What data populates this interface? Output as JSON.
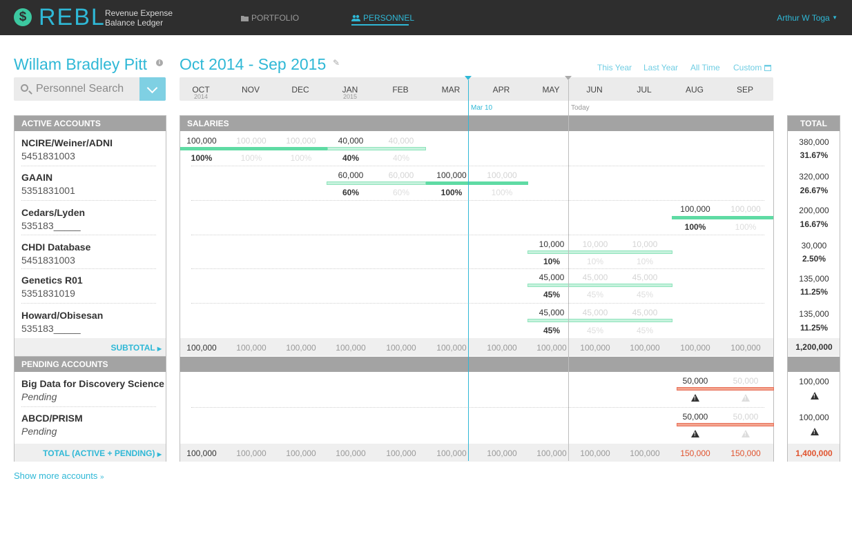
{
  "app": {
    "logo_glyph": "$",
    "name": "REBL",
    "subtitle_line1": "Revenue Expense",
    "subtitle_line2": "Balance Ledger"
  },
  "nav": {
    "portfolio": "PORTFOLIO",
    "personnel": "PERSONNEL",
    "user": "Arthur W Toga"
  },
  "person": {
    "name": "Willam Bradley Pitt"
  },
  "range": {
    "label": "Oct 2014 - Sep 2015",
    "quick": [
      "This Year",
      "Last Year",
      "All Time",
      "Custom"
    ]
  },
  "search": {
    "placeholder": "Personnel Search"
  },
  "months": [
    {
      "m": "OCT",
      "y": "2014"
    },
    {
      "m": "NOV",
      "y": ""
    },
    {
      "m": "DEC",
      "y": ""
    },
    {
      "m": "JAN",
      "y": "2015"
    },
    {
      "m": "FEB",
      "y": ""
    },
    {
      "m": "MAR",
      "y": ""
    },
    {
      "m": "APR",
      "y": ""
    },
    {
      "m": "MAY",
      "y": ""
    },
    {
      "m": "JUN",
      "y": ""
    },
    {
      "m": "JUL",
      "y": ""
    },
    {
      "m": "AUG",
      "y": ""
    },
    {
      "m": "SEP",
      "y": ""
    }
  ],
  "markers": {
    "current": "Mar 10",
    "today": "Today"
  },
  "headers": {
    "active": "ACTIVE ACCOUNTS",
    "salaries": "SALARIES",
    "total": "TOTAL",
    "pending": "PENDING ACCOUNTS",
    "subtotal": "SUBTOTAL",
    "grand_total": "TOTAL (ACTIVE + PENDING)"
  },
  "active_accounts": [
    {
      "name": "NCIRE/Weiner/ADNI",
      "id": "5451831003",
      "amounts": [
        "100,000",
        "100,000",
        "100,000",
        "40,000",
        "40,000"
      ],
      "pcts": [
        "100%",
        "100%",
        "100%",
        "40%",
        "40%"
      ],
      "total": "380,000",
      "share": "31.67%"
    },
    {
      "name": "GAAIN",
      "id": "5351831001",
      "amounts": [
        "60,000",
        "60,000",
        "100,000",
        "100,000"
      ],
      "pcts": [
        "60%",
        "60%",
        "100%",
        "100%"
      ],
      "total": "320,000",
      "share": "26.67%"
    },
    {
      "name": "Cedars/Lyden",
      "id": "535183_____",
      "amounts": [
        "100,000",
        "100,000"
      ],
      "pcts": [
        "100%",
        "100%"
      ],
      "total": "200,000",
      "share": "16.67%"
    },
    {
      "name": "CHDI Database",
      "id": "5451831003",
      "amounts": [
        "10,000",
        "10,000",
        "10,000"
      ],
      "pcts": [
        "10%",
        "10%",
        "10%"
      ],
      "total": "30,000",
      "share": "2.50%"
    },
    {
      "name": "Genetics R01",
      "id": "5351831019",
      "amounts": [
        "45,000",
        "45,000",
        "45,000"
      ],
      "pcts": [
        "45%",
        "45%",
        "45%"
      ],
      "total": "135,000",
      "share": "11.25%"
    },
    {
      "name": "Howard/Obisesan",
      "id": "535183_____",
      "amounts": [
        "45,000",
        "45,000",
        "45,000"
      ],
      "pcts": [
        "45%",
        "45%",
        "45%"
      ],
      "total": "135,000",
      "share": "11.25%"
    }
  ],
  "subtotal_row": {
    "values": [
      "100,000",
      "100,000",
      "100,000",
      "100,000",
      "100,000",
      "100,000",
      "100,000",
      "100,000",
      "100,000",
      "100,000",
      "100,000",
      "100,000"
    ],
    "total": "1,200,000"
  },
  "pending_accounts": [
    {
      "name": "Big Data for Discovery Science",
      "status": "Pending",
      "amounts": [
        "50,000",
        "50,000"
      ],
      "total": "100,000"
    },
    {
      "name": "ABCD/PRISM",
      "status": "Pending",
      "amounts": [
        "50,000",
        "50,000"
      ],
      "total": "100,000"
    }
  ],
  "grand_total_row": {
    "values": [
      "100,000",
      "100,000",
      "100,000",
      "100,000",
      "100,000",
      "100,000",
      "100,000",
      "100,000",
      "100,000",
      "100,000",
      "150,000",
      "150,000"
    ],
    "total": "1,400,000"
  },
  "show_more": "Show more accounts",
  "colors": {
    "accent": "#2fb8d6",
    "allocation_bar": "#5fdba4",
    "pending_bar": "#f3a48e",
    "over_budget": "#e0532e",
    "topbar": "#2e2e2e"
  },
  "icons": [
    "dollar-logo-icon",
    "folder-icon",
    "people-icon",
    "caret-down-icon",
    "info-icon",
    "edit-icon",
    "calendar-icon",
    "search-icon",
    "chevron-down-icon",
    "caret-right-icon",
    "warning-icon",
    "double-chevron-down-icon"
  ]
}
